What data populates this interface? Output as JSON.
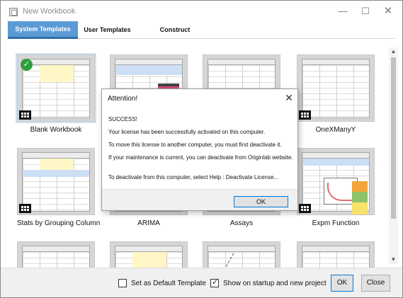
{
  "window": {
    "title": "New Workbook",
    "controls": {
      "minimize": "—",
      "maximize": "☐",
      "close": "✕"
    }
  },
  "tabs": [
    {
      "label": "System Templates",
      "active": true
    },
    {
      "label": "User Templates",
      "active": false
    },
    {
      "label": "Construct Worksheet",
      "active": false
    }
  ],
  "templates": [
    {
      "label": "Blank Workbook",
      "selected": true
    },
    {
      "label": ""
    },
    {
      "label": ""
    },
    {
      "label": "OneXManyY"
    },
    {
      "label": "Stats by Grouping Column"
    },
    {
      "label": "ARIMA"
    },
    {
      "label": "Assays"
    },
    {
      "label": "Expm Function"
    },
    {
      "label": ""
    },
    {
      "label": ""
    },
    {
      "label": ""
    },
    {
      "label": ""
    }
  ],
  "scrollbar": {
    "up_icon": "▲",
    "down_icon": "▼"
  },
  "footer": {
    "default_template_label": "Set as Default Template",
    "default_template_checked": false,
    "show_on_startup_label": "Show on startup and new project",
    "show_on_startup_checked": true,
    "ok_label": "OK",
    "close_label": "Close"
  },
  "dialog": {
    "title": "Attention!",
    "close_icon": "✕",
    "lines": [
      "SUCCESS!",
      "Your license has been successfully activated on this computer.",
      "To move this license to another computer, you must first deactivate it.",
      "If your maintenance is current, you can deactivate from Originlab website.",
      "To deactivate from this computer, select Help : Deactivate License..."
    ],
    "ok_label": "OK"
  },
  "colors": {
    "tab_active": "#5b9bd5",
    "check_badge": "#2e9e3e",
    "button_focus_border": "#0078d7"
  }
}
